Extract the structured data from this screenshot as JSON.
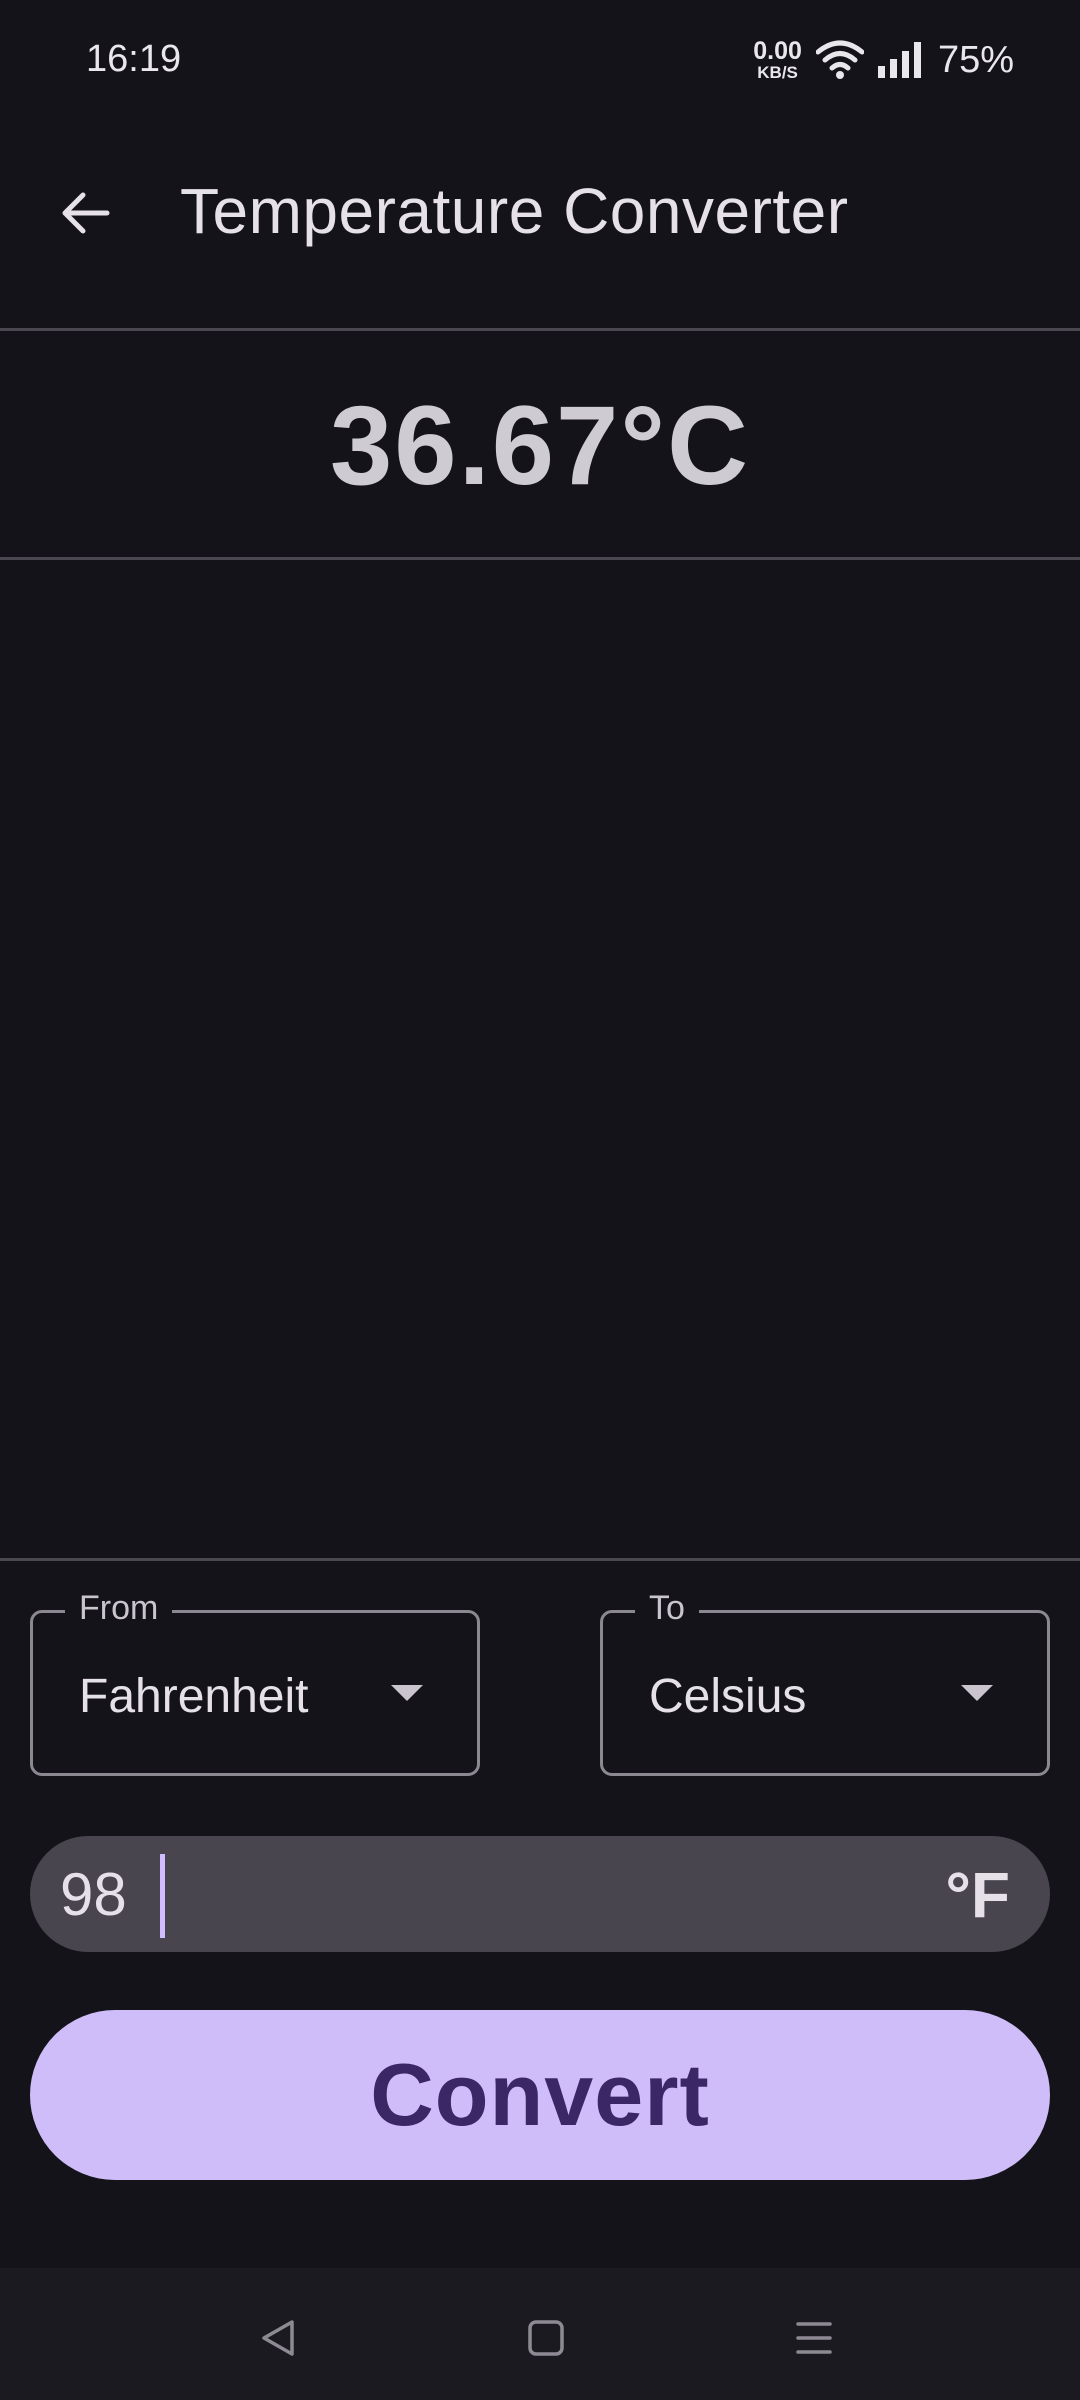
{
  "status_bar": {
    "time": "16:19",
    "net_speed_value": "0.00",
    "net_speed_unit": "KB/S",
    "battery": "75%",
    "icons": [
      "wifi-icon",
      "signal-icon"
    ]
  },
  "app_bar": {
    "back_icon": "arrow-left-icon",
    "title": "Temperature Converter"
  },
  "result": {
    "value": "36.67°C"
  },
  "from_field": {
    "label": "From",
    "value": "Fahrenheit"
  },
  "to_field": {
    "label": "To",
    "value": "Celsius"
  },
  "temperature_input": {
    "value": "98",
    "suffix": "°F"
  },
  "convert_button": {
    "label": "Convert"
  },
  "nav_bar": {
    "icons": [
      "back-triangle-icon",
      "home-square-icon",
      "recents-menu-icon"
    ]
  },
  "colors": {
    "background": "#15131a",
    "accent": "#cfbdfa",
    "accent_text": "#3b2765",
    "input_bg": "#49454f"
  }
}
